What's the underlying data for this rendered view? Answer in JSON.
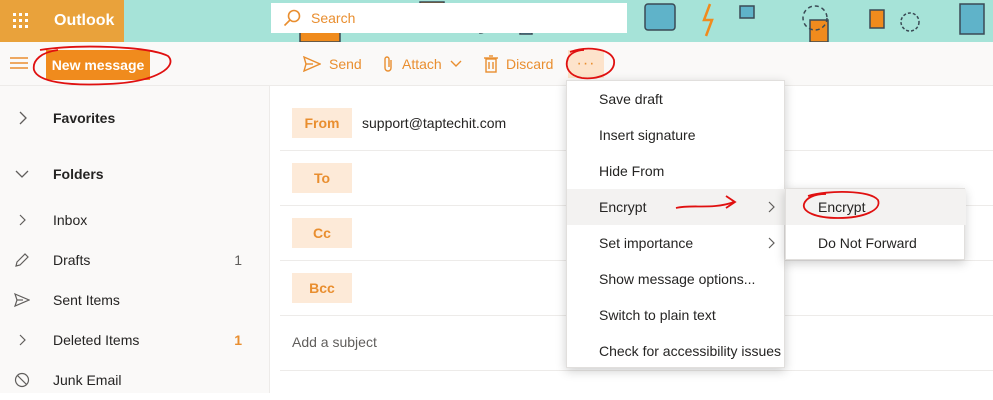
{
  "app": {
    "name": "Outlook"
  },
  "search": {
    "placeholder": "Search"
  },
  "toolbar": {
    "new_message": "New message",
    "send": "Send",
    "attach": "Attach",
    "discard": "Discard",
    "more": "···"
  },
  "sidebar": {
    "favorites": "Favorites",
    "folders": "Folders",
    "items": [
      {
        "label": "Inbox",
        "icon": "chevron-right-icon",
        "count": ""
      },
      {
        "label": "Drafts",
        "icon": "pencil-icon",
        "count": "1"
      },
      {
        "label": "Sent Items",
        "icon": "send-icon",
        "count": ""
      },
      {
        "label": "Deleted Items",
        "icon": "chevron-right-icon",
        "count": "1"
      },
      {
        "label": "Junk Email",
        "icon": "block-icon",
        "count": ""
      }
    ]
  },
  "compose": {
    "from_label": "From",
    "from_value": "support@taptechit.com",
    "to_label": "To",
    "cc_label": "Cc",
    "bcc_label": "Bcc",
    "subject_placeholder": "Add a subject"
  },
  "more_menu": {
    "items": [
      "Save draft",
      "Insert signature",
      "Hide From",
      "Encrypt",
      "Set importance",
      "Show message options...",
      "Switch to plain text",
      "Check for accessibility issues"
    ],
    "selected": "Encrypt"
  },
  "encrypt_submenu": {
    "items": [
      "Encrypt",
      "Do Not Forward"
    ],
    "selected": "Encrypt"
  },
  "colors": {
    "brand": "#e9a23b",
    "accent": "#e98e2f",
    "header_bg": "#a6e3d8",
    "annotation": "#e01010"
  }
}
